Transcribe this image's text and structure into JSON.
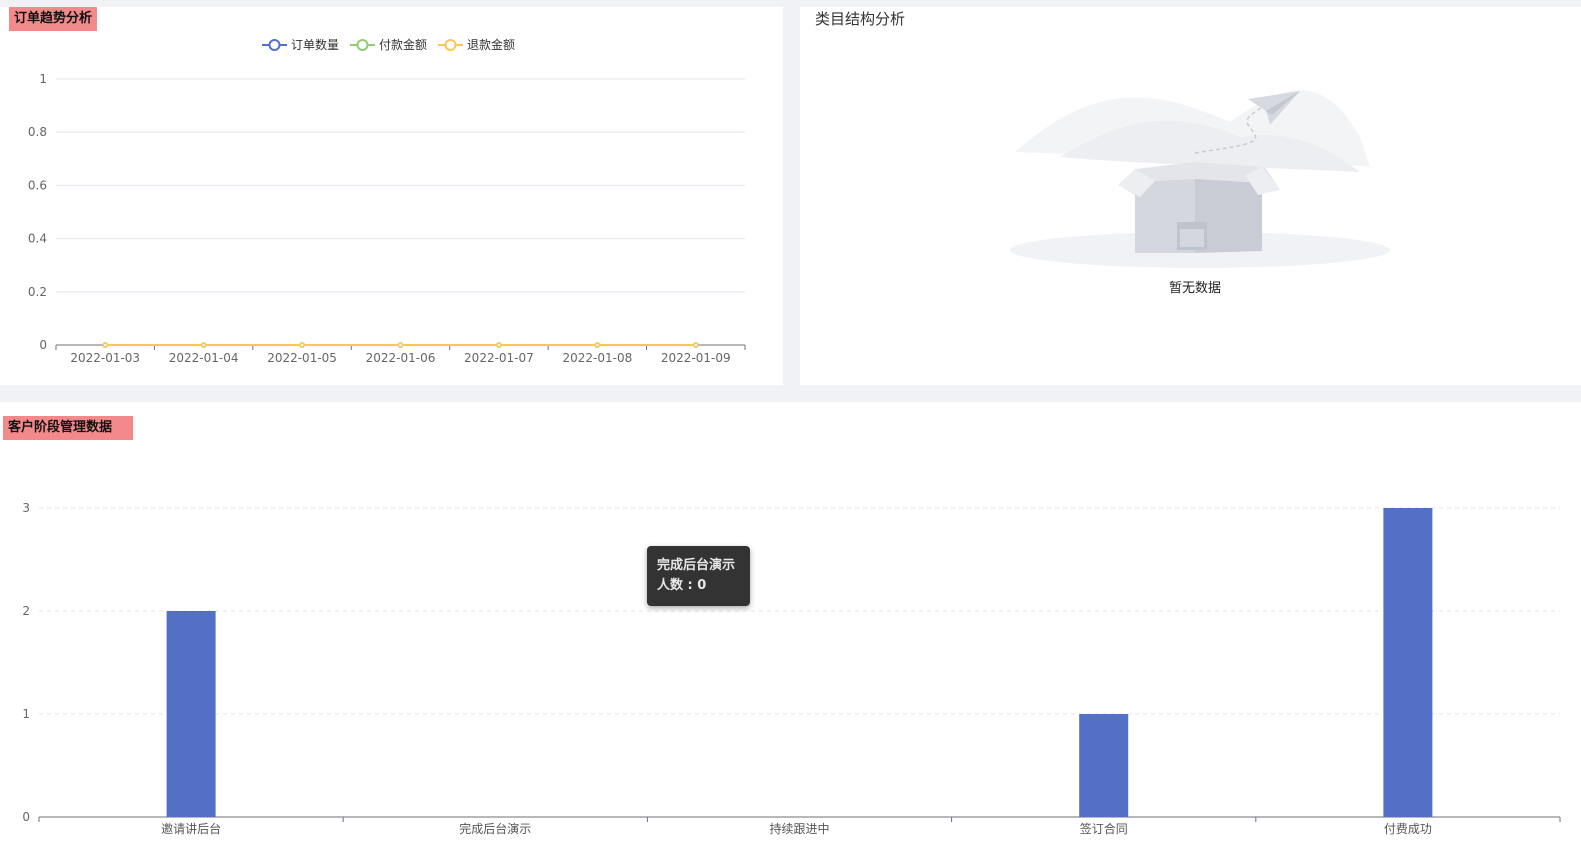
{
  "panels": {
    "trend": {
      "title": "订单趋势分析"
    },
    "category": {
      "title": "类目结构分析",
      "empty_text": "暂无数据"
    },
    "stage": {
      "title": "客户阶段管理数据"
    }
  },
  "chart_data": [
    {
      "type": "line",
      "title": "订单趋势分析",
      "legend_position": "top-center",
      "x": [
        "2022-01-03",
        "2022-01-04",
        "2022-01-05",
        "2022-01-06",
        "2022-01-07",
        "2022-01-08",
        "2022-01-09"
      ],
      "series": [
        {
          "name": "订单数量",
          "color": "#5470c6",
          "values": [
            0,
            0,
            0,
            0,
            0,
            0,
            0
          ]
        },
        {
          "name": "付款金额",
          "color": "#91cc75",
          "values": [
            0,
            0,
            0,
            0,
            0,
            0,
            0
          ]
        },
        {
          "name": "退款金额",
          "color": "#fac858",
          "values": [
            0,
            0,
            0,
            0,
            0,
            0,
            0
          ]
        }
      ],
      "ylim": [
        0,
        1
      ],
      "yticks": [
        "0",
        "0.2",
        "0.4",
        "0.6",
        "0.8",
        "1"
      ],
      "grid": true
    },
    {
      "type": "bar",
      "title": "客户阶段管理数据",
      "categories": [
        "邀请讲后台",
        "完成后台演示",
        "持续跟进中",
        "签订合同",
        "付费成功"
      ],
      "values": [
        2,
        0,
        0,
        1,
        3
      ],
      "color": "#5470c6",
      "ylim": [
        0,
        3
      ],
      "yticks": [
        "0",
        "1",
        "2",
        "3"
      ],
      "grid": true,
      "tooltip": {
        "title": "完成后台演示",
        "line": "人数 : 0"
      }
    }
  ]
}
